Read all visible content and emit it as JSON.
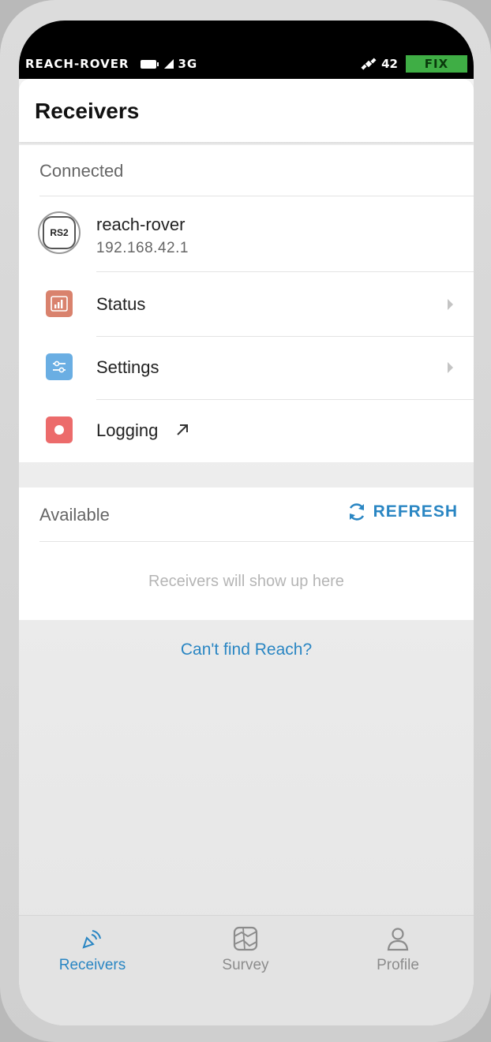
{
  "status_bar": {
    "carrier": "REACH-ROVER",
    "network": "3G",
    "satellites": "42",
    "fix": "FIX",
    "fix_color": "#3fae45"
  },
  "header": {
    "title": "Receivers"
  },
  "connected": {
    "label": "Connected",
    "device": {
      "badge": "RS2",
      "name": "reach-rover",
      "ip": "192.168.42.1"
    },
    "menu": [
      {
        "label": "Status",
        "icon": "bar-chart-icon",
        "color": "#d9826d"
      },
      {
        "label": "Settings",
        "icon": "sliders-icon",
        "color": "#6aaee3"
      },
      {
        "label": "Logging",
        "icon": "record-icon",
        "color": "#ec6b6b"
      }
    ]
  },
  "available": {
    "label": "Available",
    "refresh_label": "REFRESH",
    "empty_text": "Receivers will show up here"
  },
  "help_link": "Can't find Reach?",
  "bottom_nav": [
    {
      "label": "Receivers",
      "icon": "receiver-antenna-icon",
      "active": true
    },
    {
      "label": "Survey",
      "icon": "survey-map-icon",
      "active": false
    },
    {
      "label": "Profile",
      "icon": "user-icon",
      "active": false
    }
  ],
  "colors": {
    "accent": "#2a86c3"
  }
}
